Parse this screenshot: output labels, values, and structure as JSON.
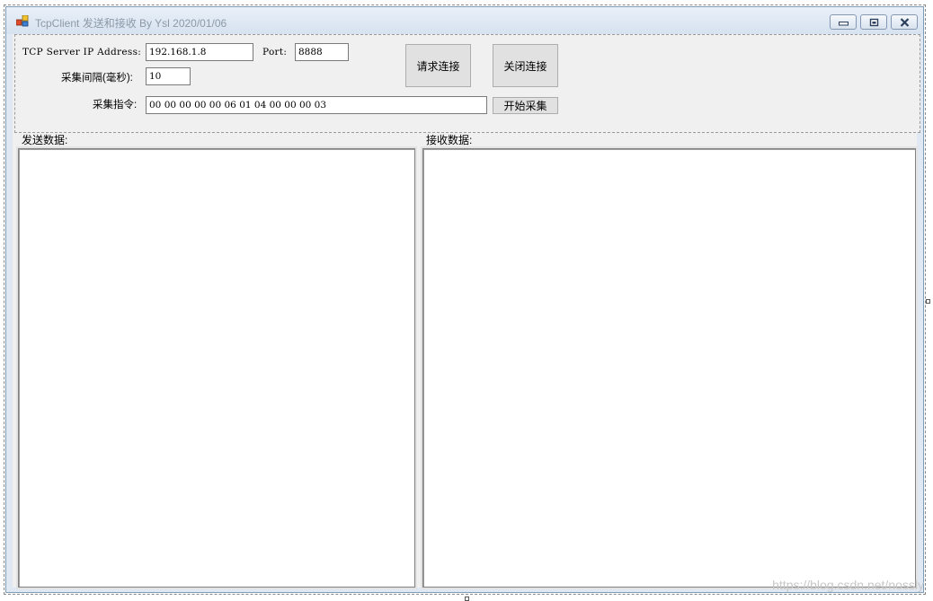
{
  "window": {
    "title": "TcpClient 发送和接收 By Ysl 2020/01/06"
  },
  "connection": {
    "ip_label": "TCP Server IP Address:",
    "ip_value": "192.168.1.8",
    "port_label": "Port:",
    "port_value": "8888",
    "interval_label": "采集间隔(毫秒):",
    "interval_value": "10",
    "command_label": "采集指令:",
    "command_value": "00 00 00 00 00 06 01 04 00 00 00 03",
    "connect_label": "请求连接",
    "disconnect_label": "关闭连接",
    "start_label": "开始采集"
  },
  "panels": {
    "send_label": "发送数据:",
    "receive_label": "接收数据:"
  },
  "watermark": "https://blog.csdn.net/nossly",
  "icons": {
    "app": "app-icon",
    "minimize": "minimize-icon",
    "restore": "restore-icon",
    "close": "close-icon"
  }
}
